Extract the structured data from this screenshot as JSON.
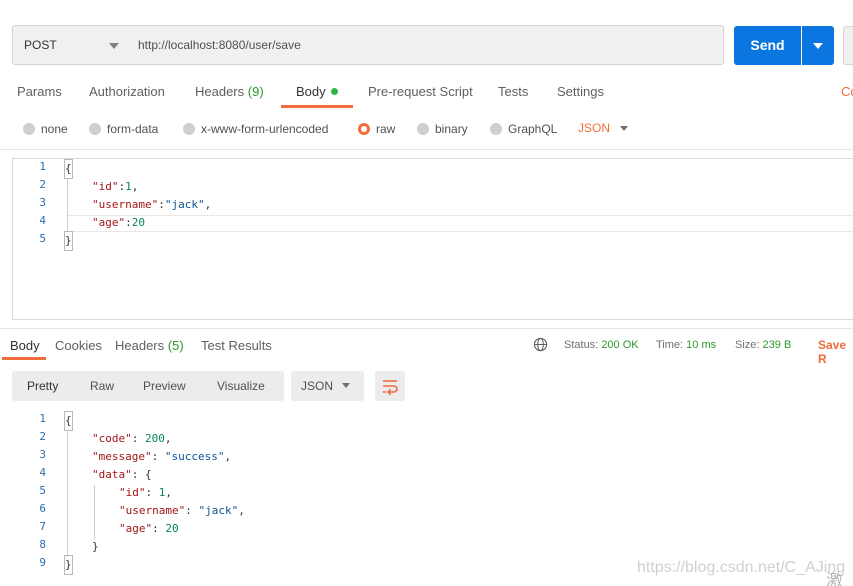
{
  "request": {
    "method": "POST",
    "url": "http://localhost:8080/user/save",
    "send_label": "Send"
  },
  "request_tabs": {
    "params": "Params",
    "authorization": "Authorization",
    "headers": "Headers",
    "headers_count": "(9)",
    "body": "Body",
    "pre_request": "Pre-request Script",
    "tests": "Tests",
    "settings": "Settings",
    "cookies_partial": "Co"
  },
  "body_types": {
    "none": "none",
    "form_data": "form-data",
    "urlencoded": "x-www-form-urlencoded",
    "raw": "raw",
    "binary": "binary",
    "graphql": "GraphQL",
    "format": "JSON"
  },
  "request_body": {
    "line_numbers": [
      "1",
      "2",
      "3",
      "4",
      "5"
    ],
    "open": "{",
    "l2_key": "\"id\"",
    "l2_sep": ":",
    "l2_val": "1",
    "l2_end": ",",
    "l3_key": "\"username\"",
    "l3_sep": ":",
    "l3_val": "\"jack\"",
    "l3_end": ",",
    "l4_key": "\"age\"",
    "l4_sep": ":",
    "l4_val": "20",
    "close": "}"
  },
  "response_tabs": {
    "body": "Body",
    "cookies": "Cookies",
    "headers": "Headers",
    "headers_count": "(5)",
    "test_results": "Test Results"
  },
  "response_status": {
    "status_label": "Status:",
    "status_value": "200 OK",
    "time_label": "Time:",
    "time_value": "10 ms",
    "size_label": "Size:",
    "size_value": "239 B",
    "save_partial": "Save R"
  },
  "response_view": {
    "pretty": "Pretty",
    "raw": "Raw",
    "preview": "Preview",
    "visualize": "Visualize",
    "format": "JSON"
  },
  "response_body": {
    "line_numbers": [
      "1",
      "2",
      "3",
      "4",
      "5",
      "6",
      "7",
      "8",
      "9"
    ],
    "open": "{",
    "code_key": "\"code\"",
    "code_val": "200",
    "message_key": "\"message\"",
    "message_val": "\"success\"",
    "data_key": "\"data\"",
    "data_open": "{",
    "id_key": "\"id\"",
    "id_val": "1",
    "username_key": "\"username\"",
    "username_val": "\"jack\"",
    "age_key": "\"age\"",
    "age_val": "20",
    "data_close": "}",
    "close": "}"
  },
  "watermark": "https://blog.csdn.net/C_AJing",
  "corner_glyph": "激",
  "colors": {
    "accent": "#f26b3a",
    "send_blue": "#0b75e0",
    "status_green": "#2a9a2a"
  }
}
